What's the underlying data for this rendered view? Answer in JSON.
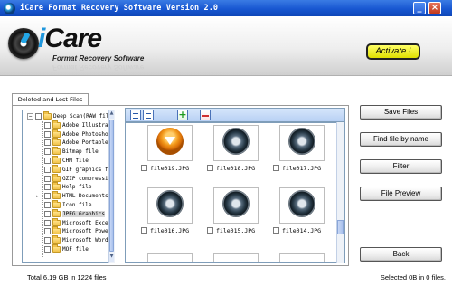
{
  "window": {
    "title": "iCare Format Recovery Software Version 2.0",
    "minimize_glyph": "_",
    "close_glyph": "×"
  },
  "logo": {
    "brand_prefix": "i",
    "brand_rest": "Care",
    "subtitle": "Format Recovery Software"
  },
  "header": {
    "activate_label": "Activate !"
  },
  "tab": {
    "label": "Deleted and Lost Files"
  },
  "tree": {
    "items": [
      {
        "label": "Deep Scan(RAW fil",
        "level": 0,
        "expander": "minus"
      },
      {
        "label": "Adobe Illustra",
        "level": 1,
        "expander": "none"
      },
      {
        "label": "Adobe Photosho",
        "level": 1,
        "expander": "none"
      },
      {
        "label": "Adobe Portable",
        "level": 1,
        "expander": "none"
      },
      {
        "label": "Bitmap file",
        "level": 1,
        "expander": "none"
      },
      {
        "label": "CHM file",
        "level": 1,
        "expander": "none"
      },
      {
        "label": "GIF graphics f",
        "level": 1,
        "expander": "none"
      },
      {
        "label": "GZIP compressi",
        "level": 1,
        "expander": "none"
      },
      {
        "label": "Help file",
        "level": 1,
        "expander": "none"
      },
      {
        "label": "HTML Documents",
        "level": 1,
        "expander": "arrow"
      },
      {
        "label": "Icon file",
        "level": 1,
        "expander": "none"
      },
      {
        "label": "JPEG Graphics",
        "level": 1,
        "expander": "none",
        "selected": true
      },
      {
        "label": "Microsoft Exce",
        "level": 1,
        "expander": "none"
      },
      {
        "label": "Microsoft Powe",
        "level": 1,
        "expander": "none"
      },
      {
        "label": "Microsoft Word",
        "level": 1,
        "expander": "none"
      },
      {
        "label": "MOF file",
        "level": 1,
        "expander": "none"
      }
    ]
  },
  "files": {
    "items": [
      {
        "name": "file019.JPG",
        "thumb": "orange"
      },
      {
        "name": "file018.JPG",
        "thumb": "gray"
      },
      {
        "name": "file017.JPG",
        "thumb": "gray"
      },
      {
        "name": "file016.JPG",
        "thumb": "gray"
      },
      {
        "name": "file015.JPG",
        "thumb": "gray"
      },
      {
        "name": "file014.JPG",
        "thumb": "gray"
      }
    ]
  },
  "actions": {
    "save_files": "Save Files",
    "find_by_name": "Find file by name",
    "filter": "Filter",
    "file_preview": "File Preview",
    "back": "Back"
  },
  "status": {
    "total": "Total 6.19 GB in 1224 files",
    "selected": "Selected 0B in 0 files."
  },
  "colors": {
    "titlebar": "#1857d1",
    "activate": "#ffff33",
    "accent": "#1f97dd"
  }
}
